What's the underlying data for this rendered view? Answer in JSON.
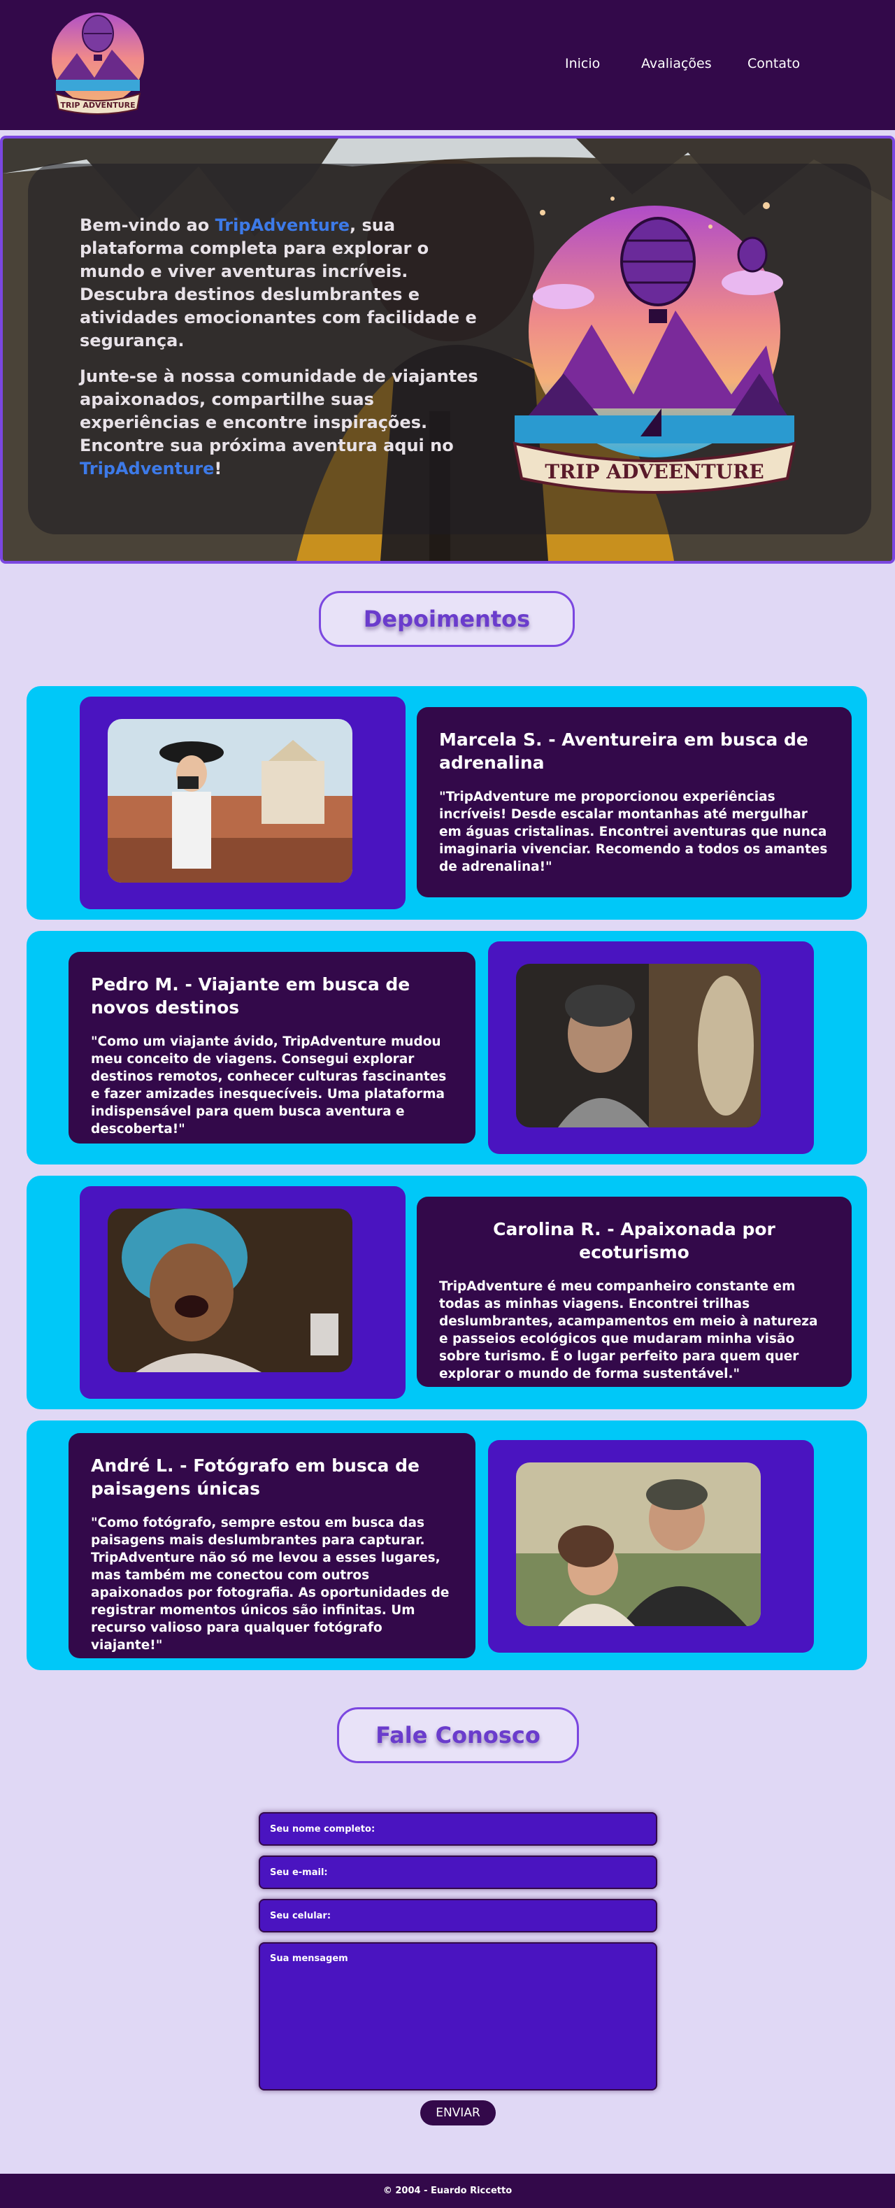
{
  "header": {
    "logo_text": "TRIP ADVENTURE",
    "nav": [
      "Inicio",
      "Avaliações",
      "Contato"
    ]
  },
  "hero": {
    "p1_before": "Bem-vindo ao ",
    "p1_brand": "TripAdventure",
    "p1_after": ", sua plataforma completa para explorar o mundo e viver aventuras incríveis. Descubra destinos deslumbrantes e atividades emocionantes com facilidade e segurança.",
    "p2_before": "Junte-se à nossa comunidade de viajantes apaixonados, compartilhe suas experiências e encontre inspirações. Encontre sua próxima aventura aqui no ",
    "p2_brand": "TripAdventure",
    "p2_after": "!",
    "art_banner": "TRIP ADVEENTURE"
  },
  "testimonials": {
    "title": "Depoimentos",
    "items": [
      {
        "name": "Marcela S. - Aventureira em busca de adrenalina",
        "quote": "\"TripAdventure me proporcionou experiências incríveis! Desde escalar montanhas até mergulhar em águas cristalinas. Encontrei aventuras que nunca imaginaria vivenciar. Recomendo a todos os amantes de adrenalina!\""
      },
      {
        "name": "Pedro M. - Viajante em busca de novos destinos",
        "quote": "\"Como um viajante ávido, TripAdventure mudou meu conceito de viagens. Consegui explorar destinos remotos, conhecer culturas fascinantes e fazer amizades inesquecíveis. Uma plataforma indispensável para quem busca aventura e descoberta!\""
      },
      {
        "name": "Carolina R. - Apaixonada por ecoturismo",
        "quote": "TripAdventure é meu companheiro constante em todas as minhas viagens. Encontrei trilhas deslumbrantes, acampamentos em meio à natureza e passeios ecológicos que mudaram minha visão sobre turismo. É o lugar perfeito para quem quer explorar o mundo de forma sustentável.\""
      },
      {
        "name": "André L. - Fotógrafo em busca de paisagens únicas",
        "quote": "\"Como fotógrafo, sempre estou em busca das paisagens mais deslumbrantes para capturar. TripAdventure não só me levou a esses lugares, mas também me conectou com outros apaixonados por fotografia. As oportunidades de registrar momentos únicos são infinitas. Um recurso valioso para qualquer fotógrafo viajante!\""
      }
    ]
  },
  "contact": {
    "title": "Fale Conosco",
    "name_placeholder": "Seu nome completo:",
    "email_placeholder": "Seu e-mail:",
    "phone_placeholder": "Seu celular:",
    "message_placeholder": "Sua mensagem",
    "send_label": "ENVIAR"
  },
  "footer": {
    "text": "© 2004 - Euardo Riccetto"
  },
  "colors": {
    "header_bg": "#33094a",
    "page_bg": "#e0d8f5",
    "accent_purple": "#7b47e0",
    "brand_blue": "#3d7ae8",
    "band_cyan": "#00c8f8",
    "photo_box": "#4a14c0"
  }
}
